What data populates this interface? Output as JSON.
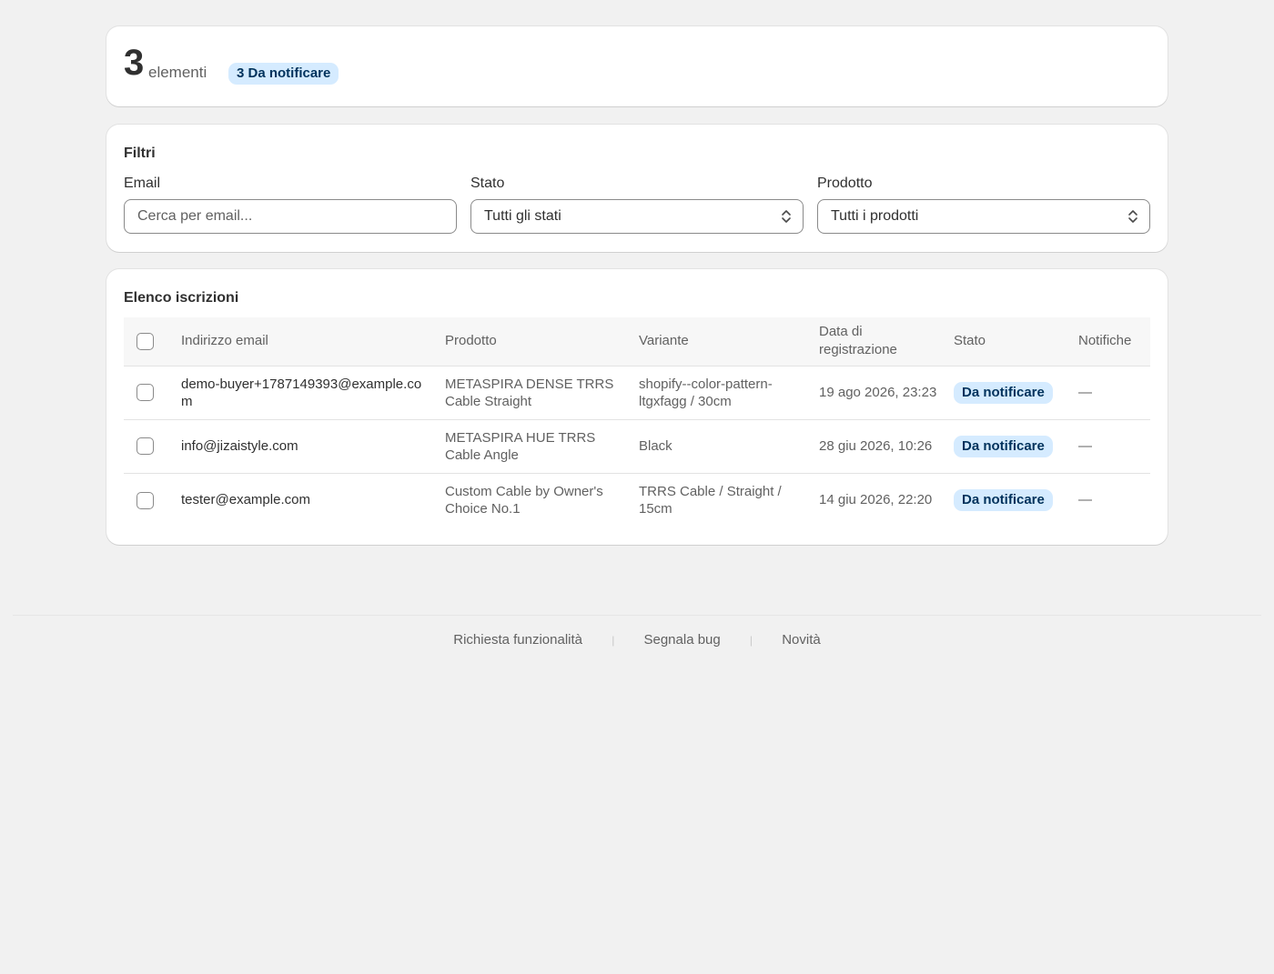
{
  "summary": {
    "count": "3",
    "count_label": "elementi",
    "badge": "3 Da notificare"
  },
  "filters": {
    "title": "Filtri",
    "email_label": "Email",
    "email_placeholder": "Cerca per email...",
    "state_label": "Stato",
    "state_value": "Tutti gli stati",
    "product_label": "Prodotto",
    "product_value": "Tutti i prodotti"
  },
  "list": {
    "title": "Elenco iscrizioni",
    "headers": {
      "email": "Indirizzo email",
      "product": "Prodotto",
      "variant": "Variante",
      "date": "Data di registrazione",
      "state": "Stato",
      "notifications": "Notifiche"
    },
    "rows": [
      {
        "email": "demo-buyer+1787149393@example.com",
        "product": "METASPIRA DENSE TRRS Cable Straight",
        "variant": "shopify--color-pattern-ltgxfagg / 30cm",
        "date": "19 ago 2026, 23:23",
        "state": "Da notificare",
        "notifications": "—"
      },
      {
        "email": "info@jizaistyle.com",
        "product": "METASPIRA HUE TRRS Cable Angle",
        "variant": "Black",
        "date": "28 giu 2026, 10:26",
        "state": "Da notificare",
        "notifications": "—"
      },
      {
        "email": "tester@example.com",
        "product": "Custom Cable by Owner's Choice No.1",
        "variant": "TRRS Cable / Straight / 15cm",
        "date": "14 giu 2026, 22:20",
        "state": "Da notificare",
        "notifications": "—"
      }
    ]
  },
  "footer": {
    "feature_request": "Richiesta funzionalità",
    "report_bug": "Segnala bug",
    "news": "Novità"
  }
}
